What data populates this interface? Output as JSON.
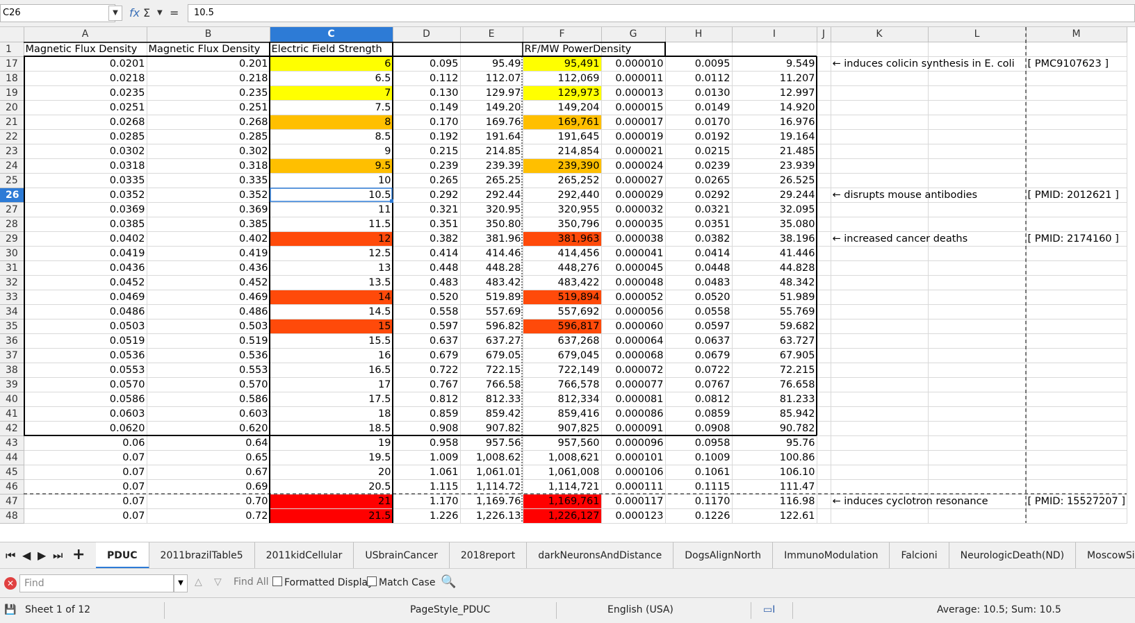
{
  "formula_bar": {
    "name_box": "C26",
    "fx_icon": "fx",
    "sum_icon": "Σ",
    "equals_icon": "=",
    "formula": "10.5"
  },
  "columns": [
    {
      "letter": "A",
      "width": 177
    },
    {
      "letter": "B",
      "width": 177
    },
    {
      "letter": "C",
      "width": 177
    },
    {
      "letter": "D",
      "width": 97
    },
    {
      "letter": "E",
      "width": 90
    },
    {
      "letter": "F",
      "width": 113
    },
    {
      "letter": "G",
      "width": 92
    },
    {
      "letter": "H",
      "width": 96
    },
    {
      "letter": "I",
      "width": 122
    },
    {
      "letter": "J",
      "width": 20
    },
    {
      "letter": "K",
      "width": 140
    },
    {
      "letter": "L",
      "width": 141
    },
    {
      "letter": "M",
      "width": 145
    }
  ],
  "selected_column": "C",
  "selected_row": "26",
  "header_row": {
    "row": "1",
    "cells": [
      "Magnetic Flux Density",
      "Magnetic Flux Density",
      "Electric Field Strength",
      "",
      "",
      "RF/MW PowerDensity",
      "",
      "",
      "",
      "",
      "",
      "",
      ""
    ]
  },
  "rows": [
    {
      "row": "17",
      "A": "0.0201",
      "B": "0.201",
      "C": "6",
      "D": "0.095",
      "E": "95.49",
      "F": "95,491",
      "G": "0.000010",
      "H": "0.0095",
      "I": "9.549",
      "K": "← induces colicin synthesis in E. coli",
      "M": "[ PMC9107623 ]",
      "hl": "yellow"
    },
    {
      "row": "18",
      "A": "0.0218",
      "B": "0.218",
      "C": "6.5",
      "D": "0.112",
      "E": "112.07",
      "F": "112,069",
      "G": "0.000011",
      "H": "0.0112",
      "I": "11.207",
      "K": "",
      "M": "",
      "hl": ""
    },
    {
      "row": "19",
      "A": "0.0235",
      "B": "0.235",
      "C": "7",
      "D": "0.130",
      "E": "129.97",
      "F": "129,973",
      "G": "0.000013",
      "H": "0.0130",
      "I": "12.997",
      "K": "",
      "M": "",
      "hl": "yellow"
    },
    {
      "row": "20",
      "A": "0.0251",
      "B": "0.251",
      "C": "7.5",
      "D": "0.149",
      "E": "149.20",
      "F": "149,204",
      "G": "0.000015",
      "H": "0.0149",
      "I": "14.920",
      "K": "",
      "M": "",
      "hl": ""
    },
    {
      "row": "21",
      "A": "0.0268",
      "B": "0.268",
      "C": "8",
      "D": "0.170",
      "E": "169.76",
      "F": "169,761",
      "G": "0.000017",
      "H": "0.0170",
      "I": "16.976",
      "K": "",
      "M": "",
      "hl": "orange"
    },
    {
      "row": "22",
      "A": "0.0285",
      "B": "0.285",
      "C": "8.5",
      "D": "0.192",
      "E": "191.64",
      "F": "191,645",
      "G": "0.000019",
      "H": "0.0192",
      "I": "19.164",
      "K": "",
      "M": "",
      "hl": ""
    },
    {
      "row": "23",
      "A": "0.0302",
      "B": "0.302",
      "C": "9",
      "D": "0.215",
      "E": "214.85",
      "F": "214,854",
      "G": "0.000021",
      "H": "0.0215",
      "I": "21.485",
      "K": "",
      "M": "",
      "hl": ""
    },
    {
      "row": "24",
      "A": "0.0318",
      "B": "0.318",
      "C": "9.5",
      "D": "0.239",
      "E": "239.39",
      "F": "239,390",
      "G": "0.000024",
      "H": "0.0239",
      "I": "23.939",
      "K": "",
      "M": "",
      "hl": "orange"
    },
    {
      "row": "25",
      "A": "0.0335",
      "B": "0.335",
      "C": "10",
      "D": "0.265",
      "E": "265.25",
      "F": "265,252",
      "G": "0.000027",
      "H": "0.0265",
      "I": "26.525",
      "K": "",
      "M": "",
      "hl": ""
    },
    {
      "row": "26",
      "A": "0.0352",
      "B": "0.352",
      "C": "10.5",
      "D": "0.292",
      "E": "292.44",
      "F": "292,440",
      "G": "0.000029",
      "H": "0.0292",
      "I": "29.244",
      "K": "← disrupts mouse antibodies",
      "M": "[ PMID: 2012621 ]",
      "hl": ""
    },
    {
      "row": "27",
      "A": "0.0369",
      "B": "0.369",
      "C": "11",
      "D": "0.321",
      "E": "320.95",
      "F": "320,955",
      "G": "0.000032",
      "H": "0.0321",
      "I": "32.095",
      "K": "",
      "M": "",
      "hl": ""
    },
    {
      "row": "28",
      "A": "0.0385",
      "B": "0.385",
      "C": "11.5",
      "D": "0.351",
      "E": "350.80",
      "F": "350,796",
      "G": "0.000035",
      "H": "0.0351",
      "I": "35.080",
      "K": "",
      "M": "",
      "hl": ""
    },
    {
      "row": "29",
      "A": "0.0402",
      "B": "0.402",
      "C": "12",
      "D": "0.382",
      "E": "381.96",
      "F": "381,963",
      "G": "0.000038",
      "H": "0.0382",
      "I": "38.196",
      "K": "← increased cancer deaths",
      "M": "[ PMID: 2174160 ]",
      "hl": "redorange"
    },
    {
      "row": "30",
      "A": "0.0419",
      "B": "0.419",
      "C": "12.5",
      "D": "0.414",
      "E": "414.46",
      "F": "414,456",
      "G": "0.000041",
      "H": "0.0414",
      "I": "41.446",
      "K": "",
      "M": "",
      "hl": ""
    },
    {
      "row": "31",
      "A": "0.0436",
      "B": "0.436",
      "C": "13",
      "D": "0.448",
      "E": "448.28",
      "F": "448,276",
      "G": "0.000045",
      "H": "0.0448",
      "I": "44.828",
      "K": "",
      "M": "",
      "hl": ""
    },
    {
      "row": "32",
      "A": "0.0452",
      "B": "0.452",
      "C": "13.5",
      "D": "0.483",
      "E": "483.42",
      "F": "483,422",
      "G": "0.000048",
      "H": "0.0483",
      "I": "48.342",
      "K": "",
      "M": "",
      "hl": ""
    },
    {
      "row": "33",
      "A": "0.0469",
      "B": "0.469",
      "C": "14",
      "D": "0.520",
      "E": "519.89",
      "F": "519,894",
      "G": "0.000052",
      "H": "0.0520",
      "I": "51.989",
      "K": "",
      "M": "",
      "hl": "redorange"
    },
    {
      "row": "34",
      "A": "0.0486",
      "B": "0.486",
      "C": "14.5",
      "D": "0.558",
      "E": "557.69",
      "F": "557,692",
      "G": "0.000056",
      "H": "0.0558",
      "I": "55.769",
      "K": "",
      "M": "",
      "hl": ""
    },
    {
      "row": "35",
      "A": "0.0503",
      "B": "0.503",
      "C": "15",
      "D": "0.597",
      "E": "596.82",
      "F": "596,817",
      "G": "0.000060",
      "H": "0.0597",
      "I": "59.682",
      "K": "",
      "M": "",
      "hl": "redorange"
    },
    {
      "row": "36",
      "A": "0.0519",
      "B": "0.519",
      "C": "15.5",
      "D": "0.637",
      "E": "637.27",
      "F": "637,268",
      "G": "0.000064",
      "H": "0.0637",
      "I": "63.727",
      "K": "",
      "M": "",
      "hl": ""
    },
    {
      "row": "37",
      "A": "0.0536",
      "B": "0.536",
      "C": "16",
      "D": "0.679",
      "E": "679.05",
      "F": "679,045",
      "G": "0.000068",
      "H": "0.0679",
      "I": "67.905",
      "K": "",
      "M": "",
      "hl": ""
    },
    {
      "row": "38",
      "A": "0.0553",
      "B": "0.553",
      "C": "16.5",
      "D": "0.722",
      "E": "722.15",
      "F": "722,149",
      "G": "0.000072",
      "H": "0.0722",
      "I": "72.215",
      "K": "",
      "M": "",
      "hl": ""
    },
    {
      "row": "39",
      "A": "0.0570",
      "B": "0.570",
      "C": "17",
      "D": "0.767",
      "E": "766.58",
      "F": "766,578",
      "G": "0.000077",
      "H": "0.0767",
      "I": "76.658",
      "K": "",
      "M": "",
      "hl": ""
    },
    {
      "row": "40",
      "A": "0.0586",
      "B": "0.586",
      "C": "17.5",
      "D": "0.812",
      "E": "812.33",
      "F": "812,334",
      "G": "0.000081",
      "H": "0.0812",
      "I": "81.233",
      "K": "",
      "M": "",
      "hl": ""
    },
    {
      "row": "41",
      "A": "0.0603",
      "B": "0.603",
      "C": "18",
      "D": "0.859",
      "E": "859.42",
      "F": "859,416",
      "G": "0.000086",
      "H": "0.0859",
      "I": "85.942",
      "K": "",
      "M": "",
      "hl": ""
    },
    {
      "row": "42",
      "A": "0.0620",
      "B": "0.620",
      "C": "18.5",
      "D": "0.908",
      "E": "907.82",
      "F": "907,825",
      "G": "0.000091",
      "H": "0.0908",
      "I": "90.782",
      "K": "",
      "M": "",
      "hl": ""
    },
    {
      "row": "43",
      "A": "0.06",
      "B": "0.64",
      "C": "19",
      "D": "0.958",
      "E": "957.56",
      "F": "957,560",
      "G": "0.000096",
      "H": "0.0958",
      "I": "95.76",
      "K": "",
      "M": "",
      "hl": ""
    },
    {
      "row": "44",
      "A": "0.07",
      "B": "0.65",
      "C": "19.5",
      "D": "1.009",
      "E": "1,008.62",
      "F": "1,008,621",
      "G": "0.000101",
      "H": "0.1009",
      "I": "100.86",
      "K": "",
      "M": "",
      "hl": ""
    },
    {
      "row": "45",
      "A": "0.07",
      "B": "0.67",
      "C": "20",
      "D": "1.061",
      "E": "1,061.01",
      "F": "1,061,008",
      "G": "0.000106",
      "H": "0.1061",
      "I": "106.10",
      "K": "",
      "M": "",
      "hl": ""
    },
    {
      "row": "46",
      "A": "0.07",
      "B": "0.69",
      "C": "20.5",
      "D": "1.115",
      "E": "1,114.72",
      "F": "1,114,721",
      "G": "0.000111",
      "H": "0.1115",
      "I": "111.47",
      "K": "",
      "M": "",
      "hl": ""
    },
    {
      "row": "47",
      "A": "0.07",
      "B": "0.70",
      "C": "21",
      "D": "1.170",
      "E": "1,169.76",
      "F": "1,169,761",
      "G": "0.000117",
      "H": "0.1170",
      "I": "116.98",
      "K": "← induces cyclotron resonance",
      "M": "[ PMID: 15527207 ]",
      "hl": "red"
    },
    {
      "row": "48",
      "A": "0.07",
      "B": "0.72",
      "C": "21.5",
      "D": "1.226",
      "E": "1,226.13",
      "F": "1,226,127",
      "G": "0.000123",
      "H": "0.1226",
      "I": "122.61",
      "K": "",
      "M": "",
      "hl": "red"
    }
  ],
  "highlight_colors": {
    "yellow": "#ffff00",
    "orange": "#ffbf00",
    "redorange": "#ff4a0a",
    "red": "#ff0000",
    "selection": "#2d7bd6"
  },
  "sheet_tabs": [
    "PDUC",
    "2011brazilTable5",
    "2011kidCellular",
    "USbrainCancer",
    "2018report",
    "darkNeuronsAndDistance",
    "DogsAlignNorth",
    "ImmunoModulation",
    "Falcioni",
    "NeurologicDeath(ND)",
    "MoscowSigna"
  ],
  "active_tab": "PDUC",
  "find_toolbar": {
    "placeholder": "Find",
    "find_all": "Find All",
    "formatted_display": "Formatted Display",
    "match_case": "Match Case"
  },
  "status_bar": {
    "sheet_info": "Sheet 1 of 12",
    "page_style": "PageStyle_PDUC",
    "language": "English (USA)",
    "summary": "Average: 10.5; Sum: 10.5"
  }
}
